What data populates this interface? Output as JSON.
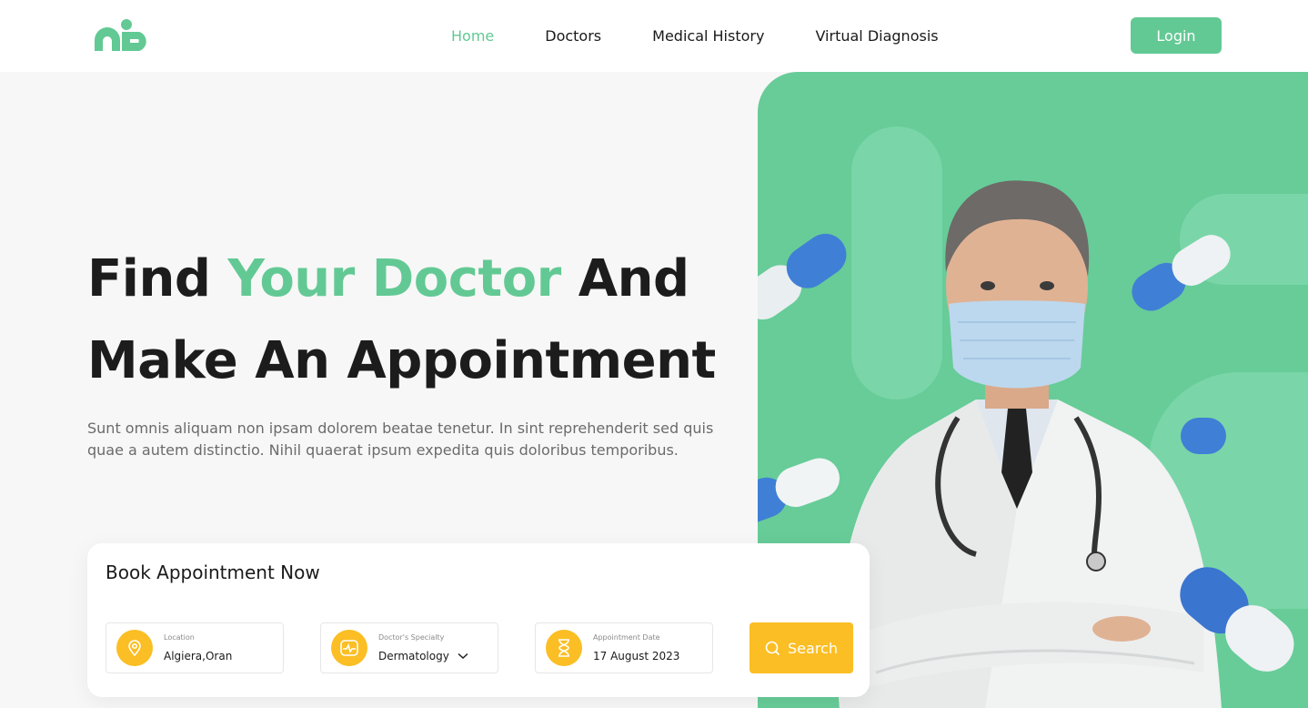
{
  "brand": {
    "logo_icon": "brand-logo-icon",
    "accent_color": "#63c994",
    "secondary_color": "#fbbe24"
  },
  "nav": {
    "items": [
      {
        "label": "Home",
        "active": true
      },
      {
        "label": "Doctors",
        "active": false
      },
      {
        "label": "Medical History",
        "active": false
      },
      {
        "label": "Virtual Diagnosis",
        "active": false
      }
    ],
    "login_label": "Login"
  },
  "hero": {
    "title_part1": "Find ",
    "title_accent": "Your Doctor",
    "title_part2": " And",
    "title_line2": "Make An Appointment",
    "description": "Sunt omnis aliquam non ipsam dolorem beatae tenetur. In sint reprehenderit sed quis quae a autem distinctio. Nihil quaerat ipsum expedita quis doloribus temporibus."
  },
  "booking": {
    "title": "Book Appointment Now",
    "fields": [
      {
        "label": "Location",
        "value": "Algiera,Oran",
        "icon": "location-pin-icon"
      },
      {
        "label": "Doctor's Specialty",
        "value": "Dermatology",
        "icon": "pulse-monitor-icon"
      },
      {
        "label": "Appointment Date",
        "value": "17 August 2023",
        "icon": "hourglass-icon"
      }
    ],
    "search_label": "Search"
  }
}
